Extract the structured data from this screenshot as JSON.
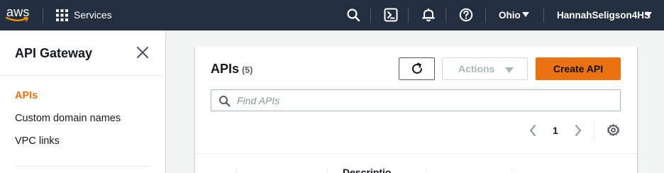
{
  "topnav": {
    "logo_text": "aws",
    "services_label": "Services",
    "region_label": "Ohio",
    "user_label": "HannahSeligson4HS",
    "icons": [
      "search-icon",
      "cloudshell-icon",
      "bell-icon",
      "help-icon"
    ]
  },
  "sidebar": {
    "title": "API Gateway",
    "items": [
      {
        "label": "APIs",
        "active": true
      },
      {
        "label": "Custom domain names",
        "active": false
      },
      {
        "label": "VPC links",
        "active": false
      }
    ]
  },
  "main": {
    "title": "APIs",
    "count": "(5)",
    "actions_label": "Actions",
    "create_label": "Create API",
    "search_placeholder": "Find APIs",
    "page_number": "1",
    "column_headers": [
      "Descriptio"
    ]
  },
  "colors": {
    "nav_bg": "#232f3e",
    "accent": "#ec7211",
    "page_bg": "#f2f3f3"
  }
}
